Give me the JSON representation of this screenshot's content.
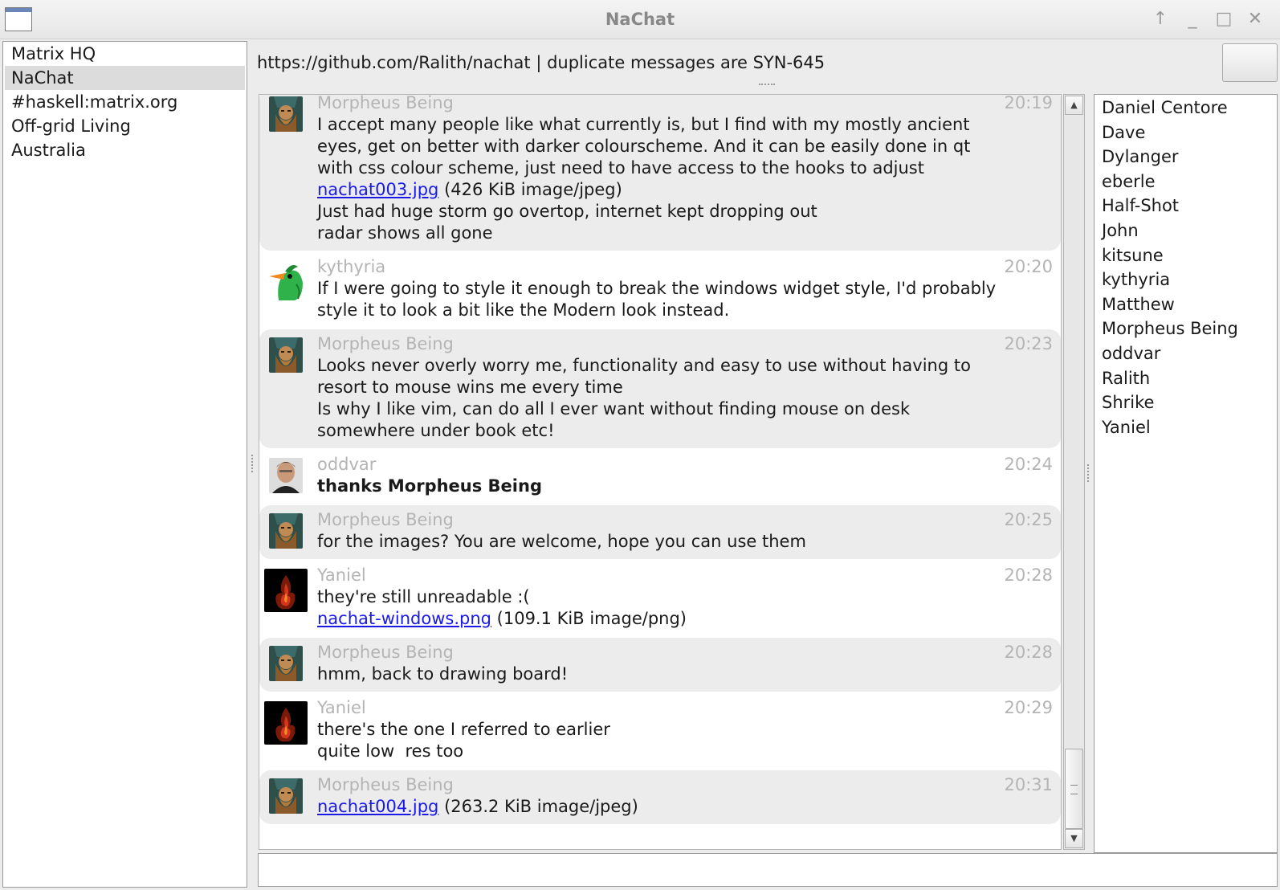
{
  "window": {
    "title": "NaChat",
    "buttons": {
      "up": "↑",
      "minimize": "_",
      "maximize": "□",
      "close": "✕"
    }
  },
  "rooms": [
    {
      "label": "Matrix HQ",
      "selected": false
    },
    {
      "label": "NaChat",
      "selected": true
    },
    {
      "label": "#haskell:matrix.org",
      "selected": false
    },
    {
      "label": "Off-grid Living",
      "selected": false
    },
    {
      "label": "Australia",
      "selected": false
    }
  ],
  "topic": "https://github.com/Ralith/nachat | duplicate messages are SYN-645",
  "messages": [
    {
      "sender": "Morpheus Being",
      "time": "20:19",
      "avatar": "dwarf-avatar",
      "bg": "gray",
      "lines": [
        {
          "text": "I accept many people like what currently is, but I find with my mostly ancient"
        },
        {
          "text": "eyes, get on better with darker colourscheme. And it can be easily done in qt"
        },
        {
          "text": "with css colour scheme, just need to have access to the hooks to adjust"
        },
        {
          "link": "nachat003.jpg",
          "text": " (426 KiB image/jpeg)"
        },
        {
          "text": "Just had huge storm go overtop, internet kept dropping out"
        },
        {
          "text": "radar shows all gone"
        }
      ]
    },
    {
      "sender": "kythyria",
      "time": "20:20",
      "avatar": "bird-avatar",
      "bg": "white",
      "lines": [
        {
          "text": "If I were going to style it enough to break the windows widget style, I'd probably"
        },
        {
          "text": "style it to look a bit like the Modern look instead."
        }
      ]
    },
    {
      "sender": "Morpheus Being",
      "time": "20:23",
      "avatar": "dwarf-avatar",
      "bg": "gray",
      "lines": [
        {
          "text": "Looks never overly worry me, functionality and easy to use without having to"
        },
        {
          "text": "resort to mouse wins me every time"
        },
        {
          "text": "Is why I like vim, can do all I ever want without finding mouse on desk"
        },
        {
          "text": "somewhere under book etc!"
        }
      ]
    },
    {
      "sender": "oddvar",
      "time": "20:24",
      "avatar": "photo-avatar",
      "bg": "white",
      "lines": [
        {
          "text": "thanks Morpheus Being",
          "bold": true
        }
      ]
    },
    {
      "sender": "Morpheus Being",
      "time": "20:25",
      "avatar": "dwarf-avatar",
      "bg": "gray",
      "lines": [
        {
          "text": "for the images? You are welcome, hope you can use them"
        }
      ]
    },
    {
      "sender": "Yaniel",
      "time": "20:28",
      "avatar": "flame-avatar",
      "bg": "white",
      "lines": [
        {
          "text": "they're still unreadable :("
        },
        {
          "link": "nachat-windows.png",
          "text": " (109.1 KiB image/png)"
        }
      ]
    },
    {
      "sender": "Morpheus Being",
      "time": "20:28",
      "avatar": "dwarf-avatar",
      "bg": "gray",
      "lines": [
        {
          "text": "hmm, back to drawing board!"
        }
      ]
    },
    {
      "sender": "Yaniel",
      "time": "20:29",
      "avatar": "flame-avatar",
      "bg": "white",
      "lines": [
        {
          "text": "there's the one I referred to earlier"
        },
        {
          "text": "quite low  res too"
        }
      ]
    },
    {
      "sender": "Morpheus Being",
      "time": "20:31",
      "avatar": "dwarf-avatar",
      "bg": "gray",
      "lines": [
        {
          "link": "nachat004.jpg",
          "text": " (263.2 KiB image/jpeg)"
        }
      ]
    }
  ],
  "members": [
    "Daniel Centore",
    "Dave",
    "Dylanger",
    "eberle",
    "Half-Shot",
    "John",
    "kitsune",
    "kythyria",
    "Matthew",
    "Morpheus Being",
    "oddvar",
    "Ralith",
    "Shrike",
    "Yaniel"
  ],
  "scrollbar": {
    "position": 0.95
  },
  "composer": {
    "value": ""
  }
}
